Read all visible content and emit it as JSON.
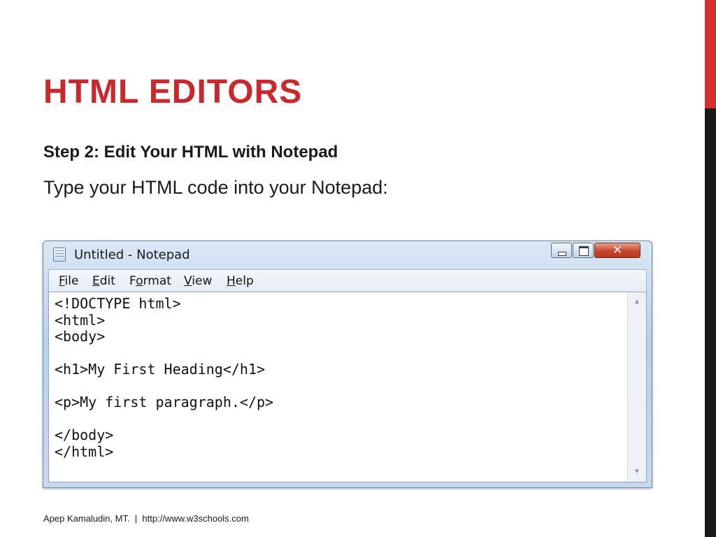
{
  "slide": {
    "title": "HTML EDITORS",
    "step_heading": "Step 2: Edit Your HTML with Notepad",
    "step_body": "Type your HTML code into your Notepad:"
  },
  "notepad": {
    "window_title": "Untitled - Notepad",
    "close_glyph": "✕",
    "menu": {
      "file": {
        "accel": "F",
        "rest": "ile"
      },
      "edit": {
        "accel": "E",
        "rest": "dit"
      },
      "format": {
        "pre": "F",
        "accel": "o",
        "rest": "rmat"
      },
      "view": {
        "accel": "V",
        "rest": "iew"
      },
      "help": {
        "accel": "H",
        "rest": "elp"
      }
    },
    "content": "<!DOCTYPE html>\n<html>\n<body>\n\n<h1>My First Heading</h1>\n\n<p>My first paragraph.</p>\n\n</body>\n</html>",
    "scroll_up": "▲",
    "scroll_down": "▼"
  },
  "footer": {
    "author": "Apep Kamaludin, MT.",
    "separator": "  |  ",
    "source": "http://www.w3schools.com"
  },
  "colors": {
    "title_red": "#c9282d",
    "accent_bar_red": "#d32f2f",
    "accent_bar_dark": "#1a1a1a"
  }
}
